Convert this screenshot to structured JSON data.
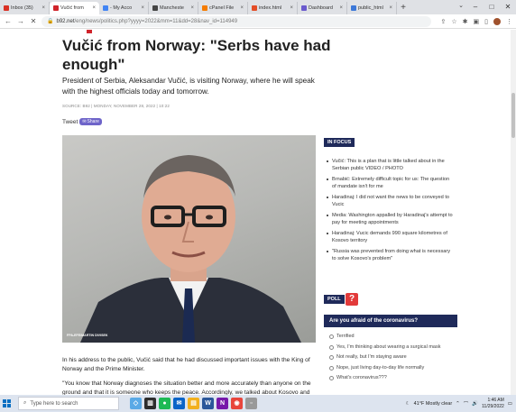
{
  "browser": {
    "tabs": [
      {
        "label": "Inbox (35)",
        "color": "#d93025",
        "active": false
      },
      {
        "label": "Vučić from",
        "color": "#d0242b",
        "active": true
      },
      {
        "label": "- My Acco",
        "color": "#4285f4",
        "active": false
      },
      {
        "label": "Mancheste",
        "color": "#444444",
        "active": false
      },
      {
        "label": "cPanel File",
        "color": "#f57c00",
        "active": false
      },
      {
        "label": "index.html",
        "color": "#e44d26",
        "active": false
      },
      {
        "label": "Dashboard",
        "color": "#6a5acd",
        "active": false
      },
      {
        "label": "public_html",
        "color": "#3c78d8",
        "active": false
      }
    ],
    "url_host": "b92.net",
    "url_path": "/eng/news/politics.php?yyyy=2022&mm=11&dd=28&nav_id=114949"
  },
  "article": {
    "headline": "Vučić from Norway: \"Serbs have had enough\"",
    "lead": "President of Serbia, Aleksandar Vučić, is visiting Norway, where he will speak with the highest officials today and tomorrow.",
    "source": "SOURCE: B92 | MONDAY, NOVEMBER 28, 2022 | 10:22",
    "tweet_label": "Tweet",
    "share_label": "Share",
    "photo_credit": "FPA-EFE/MARTIN DIVISEK",
    "paragraphs": [
      "In his address to the public, Vučić said that he had discussed important issues with the King of Norway and the Prime Minister.",
      "\"You know that Norway diagnoses the situation better and more accurately than anyone on the ground and that it is someone who keeps the peace. Accordingly, we talked about Kosovo and Metohija, about the dialogue process itself. As usual, I did not shift the blame to the other side. There is no doubts that they will continue to"
    ]
  },
  "sidebar": {
    "focus_title": "IN FOCUS",
    "focus_items": [
      "Vučić: This is a plan that is little talked about in the Serbian public VIDEO / PHOTO",
      "Brnabić: Extremely difficult topic for us: The question of mandate isn't for me",
      "Haradinaj: I did not want the news to be conveyed to Vucic",
      "Media: Washington appalled by Haradinaj's attempt to pay for meeting appointments",
      "Haradinaj: Vucic demands 990 square kilometres of Kosovo territory",
      "\"Russia was prevented from doing what is necessary to solve Kosovo's problem\""
    ],
    "poll_title": "POLL",
    "poll_badge": "?",
    "poll_question": "Are you afraid of the coronavirus?",
    "poll_options": [
      "Terrified",
      "Yes, I'm thinking about wearing a surgical mask",
      "Not really, but I'm staying aware",
      "Nope, just living day-to-day life normally",
      "What's coronavirus???"
    ]
  },
  "taskbar": {
    "search_placeholder": "Type here to search",
    "weather": "41°F  Mostly clear",
    "time": "1:46 AM",
    "date": "11/29/2022"
  }
}
